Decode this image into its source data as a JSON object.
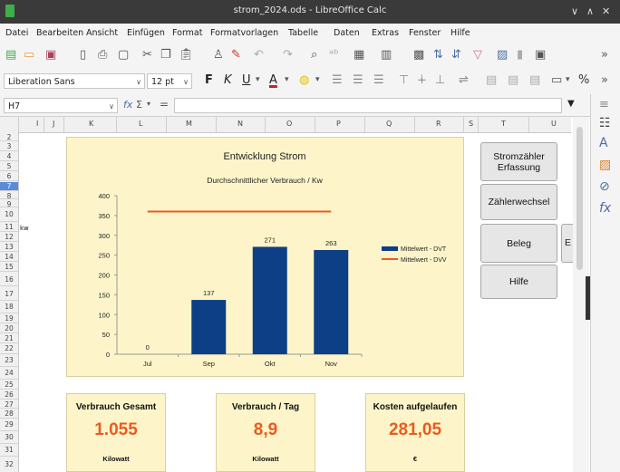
{
  "window": {
    "title": "strom_2024.ods - LibreOffice Calc",
    "controls": [
      "∨",
      "∧",
      "✕"
    ]
  },
  "menu": [
    "Datei",
    "Bearbeiten",
    "Ansicht",
    "Einfügen",
    "Format",
    "Formatvorlagen",
    "Tabelle",
    "Daten",
    "Extras",
    "Fenster",
    "Hilfe"
  ],
  "format_bar": {
    "font_name": "Liberation Sans",
    "font_size": "12 pt",
    "bold": "F",
    "italic": "K",
    "underline": "U"
  },
  "formula_bar": {
    "cell_ref": "H7",
    "fx": "fx",
    "sum": "Σ",
    "equals": "="
  },
  "columns": [
    "I",
    "J",
    "K",
    "L",
    "M",
    "N",
    "O",
    "P",
    "Q",
    "R",
    "S",
    "T",
    "U"
  ],
  "rows": [
    "2",
    "3",
    "4",
    "5",
    "6",
    "7",
    "8",
    "9",
    "10",
    "11",
    "12",
    "13",
    "14",
    "15",
    "16",
    "17",
    "18",
    "19",
    "20",
    "21",
    "22",
    "23",
    "24",
    "25",
    "26",
    "27",
    "28",
    "29",
    "30",
    "31",
    "32"
  ],
  "row_label_kw": "kw",
  "chart_data": {
    "type": "bar",
    "title": "Entwicklung Strom",
    "subtitle": "Durchschnittlicher Verbrauch / Kw",
    "categories": [
      "Jul",
      "Sep",
      "Okt",
      "Nov"
    ],
    "series": [
      {
        "name": "Mittelwert - DVT",
        "type": "bar",
        "values": [
          0,
          137,
          271,
          263
        ],
        "color": "#0d3f87"
      },
      {
        "name": "Mittelwert - DVV",
        "type": "line",
        "values": [
          360,
          360,
          360,
          360
        ],
        "color": "#ec5a20"
      }
    ],
    "data_labels": [
      "0",
      "137",
      "271",
      "263"
    ],
    "ylim": [
      0,
      400
    ],
    "yticks": [
      "0",
      "50",
      "100",
      "150",
      "200",
      "250",
      "300",
      "350",
      "400"
    ],
    "legend_position": "right",
    "grid": false
  },
  "buttons": {
    "stromzaehler": [
      "Stromzähler",
      "Erfassung"
    ],
    "zaehlerwechsel": "Zählerwechsel",
    "beleg": "Beleg",
    "hilfe": "Hilfe",
    "partial_e": "E"
  },
  "summary": [
    {
      "heading": "Verbrauch Gesamt",
      "value": "1.055",
      "unit": "Kilowatt"
    },
    {
      "heading": "Verbrauch / Tag",
      "value": "8,9",
      "unit": "Kilowatt"
    },
    {
      "heading": "Kosten aufgelaufen",
      "value": "281,05",
      "unit": "€"
    }
  ],
  "colors": {
    "accent_orange": "#ec5a20",
    "bar_blue": "#0d3f87",
    "chart_bg": "#fdf5c9",
    "titlebar": "#3a3a3a"
  }
}
